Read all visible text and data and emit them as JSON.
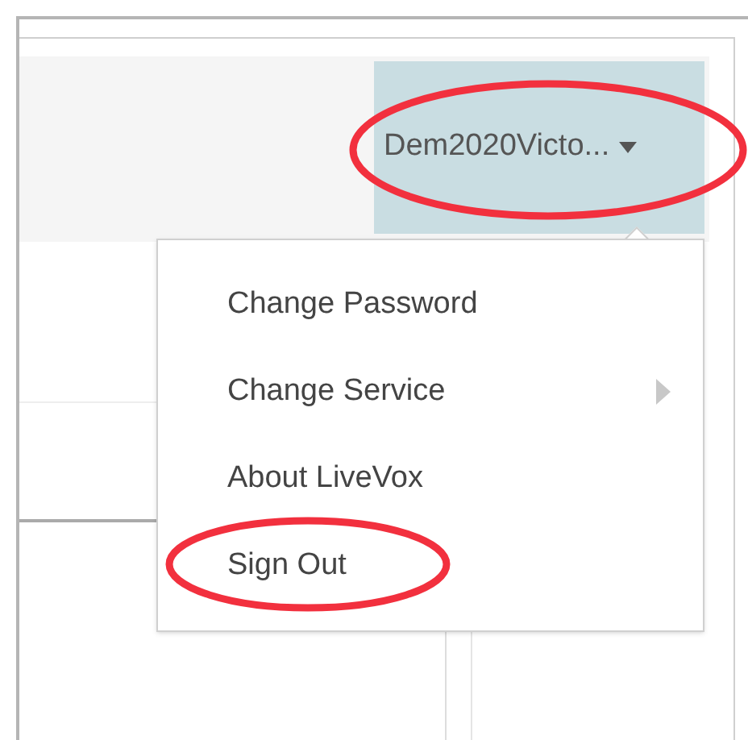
{
  "user_menu": {
    "label": "Dem2020Victo...",
    "expanded": true,
    "circled": true
  },
  "menu_items": [
    {
      "label": "Change Password",
      "kind": "plain",
      "circled": false
    },
    {
      "label": "Change Service",
      "kind": "submenu",
      "circled": false
    },
    {
      "label": "About LiveVox",
      "kind": "plain",
      "circled": false
    },
    {
      "label": "Sign Out",
      "kind": "plain",
      "circled": true
    }
  ]
}
